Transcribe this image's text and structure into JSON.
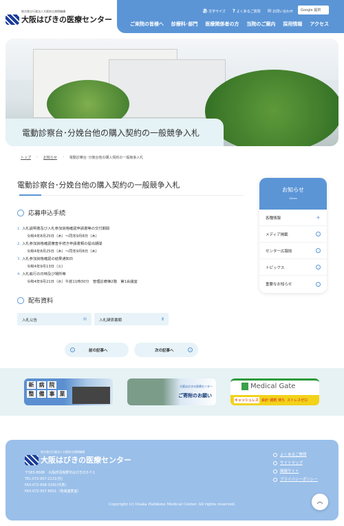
{
  "header": {
    "logo_sub": "地方独立行政法人大阪府立病院機構",
    "logo_main": "大阪はびきの医療センター",
    "utility": [
      {
        "icon": "font-size-icon",
        "glyph": "あ",
        "label": "文字サイズ"
      },
      {
        "icon": "question-icon",
        "glyph": "?",
        "label": "よくあるご質問"
      },
      {
        "icon": "mail-icon",
        "glyph": "✉",
        "label": "お問い合わせ"
      }
    ],
    "search_label": "Google 提供",
    "menu": [
      "ご来院の皆様へ",
      "診療科･部門",
      "医療関係者の方",
      "当院のご案内",
      "採用情報",
      "アクセス"
    ]
  },
  "hero": {
    "title": "電動診察台･分娩台他の購入契約の一般競争入札"
  },
  "breadcrumb": [
    "トップ",
    "お知らせ",
    "電動診察台･分娩台他の購入契約の一般競争入札"
  ],
  "main": {
    "title": "電動診察台･分娩台他の購入契約の一般競争入札",
    "section1": "応募申込手続",
    "items": [
      {
        "n": "1.",
        "text": "入札説明書及び入札参加資格確認申請書等の交付期間",
        "sub": "令和4年8月25日（木）～同年9月8日（木）"
      },
      {
        "n": "2.",
        "text": "入札参加資格確認審査手続き申請書類の提出期間",
        "sub": "令和4年8月25日（木）～同年9月8日（木）"
      },
      {
        "n": "3.",
        "text": "入札参加資格確認の結果通知日",
        "sub": "令和4年9月13日（火）"
      },
      {
        "n": "4.",
        "text": "入札執行の日時及び場所等",
        "sub": "令和4年9月21日（水）午前11時30分　管理診療棟2階　第1会議室"
      }
    ],
    "section2": "配布資料",
    "docs": [
      "入札公告",
      "入札関係書類"
    ],
    "prev": "前の記事へ",
    "next": "次の記事へ"
  },
  "sidebar": {
    "title": "お知らせ",
    "subtitle": "News",
    "items": [
      {
        "label": "各種情報",
        "icon": "plus-icon"
      },
      {
        "label": "メディア掲載",
        "icon": "chevron-circle-icon"
      },
      {
        "label": "センター広報誌",
        "icon": "chevron-circle-icon"
      },
      {
        "label": "トピックス",
        "icon": "chevron-circle-icon"
      },
      {
        "label": "重要なお知らせ",
        "icon": "chevron-circle-icon"
      }
    ]
  },
  "banners": {
    "b1": [
      "新",
      "病",
      "院",
      "整",
      "備",
      "事",
      "業"
    ],
    "b2_sub": "大阪はびきの医療センター",
    "b2_main": "ご寄附のお願い",
    "b3_main": "Medical Gate",
    "b3_a": "キャッシュレス",
    "b3_b": "会計･調剤 待ち",
    "b3_c": "ストレスゼロ"
  },
  "footer": {
    "logo_sub": "地方独立行政法人大阪府立病院機構",
    "logo_main": "大阪はびきの医療センター",
    "address": [
      "〒583-8588　大阪府羽曳野市はびきの3-7-1",
      "TEL:072-957-2121(代)",
      "FAX:072-958-3291(代表)",
      "FAX:072-957-8051（地域連携室）"
    ],
    "links": [
      "よくあるご質問",
      "サイトマップ",
      "関連サイト",
      "プライバシーポリシー"
    ],
    "copyright": "Copyright (c) Osaka Habikino Medical Center. All rights reserved."
  },
  "colors": {
    "accent": "#5b95d6",
    "footer": "#9abfe9",
    "light": "#e7f3f8"
  }
}
